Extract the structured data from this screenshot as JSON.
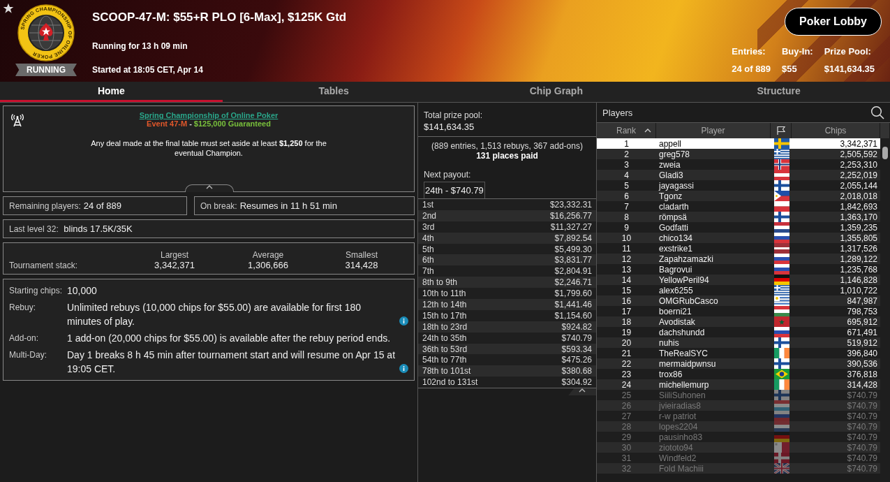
{
  "header": {
    "logo_text": "SPRING CHAMPIONSHIP OF ONLINE POKER",
    "status_badge": "RUNNING",
    "title": "SCOOP-47-M: $55+R PLO [6-Max], $125K Gtd",
    "running_for": "Running for 13 h 09 min",
    "started_at": "Started at 18:05 CET, Apr 14",
    "lobby_button": "Poker Lobby",
    "stats": [
      {
        "label": "Entries:",
        "value": "24 of 889"
      },
      {
        "label": "Buy-In:",
        "value": "$55"
      },
      {
        "label": "Prize Pool:",
        "value": "$141,634.35"
      }
    ]
  },
  "tabs": [
    {
      "label": "Home",
      "selected": true
    },
    {
      "label": "Tables",
      "selected": false
    },
    {
      "label": "Chip Graph",
      "selected": false
    },
    {
      "label": "Structure",
      "selected": false
    }
  ],
  "info": {
    "link": "Spring Championship of Online Poker",
    "event": "Event 47-M",
    "separator": "-",
    "guarantee": "$125,000 Guaranteed",
    "notice": "Any deal made at the final table must set aside at least **$1,250** for the eventual Champion."
  },
  "remaining": {
    "label": "Remaining players:",
    "value": "24 of 889"
  },
  "on_break": {
    "label": "On break:",
    "value": "Resumes in 11 h 51 min"
  },
  "last_level": {
    "label": "Last level 32:",
    "value": "blinds 17.5K/35K"
  },
  "stack": {
    "label": "Tournament stack:",
    "columns": [
      {
        "heading": "Largest",
        "value": "3,342,371"
      },
      {
        "heading": "Average",
        "value": "1,306,666"
      },
      {
        "heading": "Smallest",
        "value": "314,428"
      }
    ]
  },
  "details": [
    {
      "label": "Starting chips:",
      "value": "10,000",
      "info": false
    },
    {
      "label": "Rebuy:",
      "value": "Unlimited rebuys (10,000 chips for $55.00) are available for first 180 minutes of play.",
      "info": true
    },
    {
      "label": "Add-on:",
      "value": "1 add-on (20,000 chips for $55.00) is available after the rebuy period ends.",
      "info": false
    },
    {
      "label": "Multi-Day:",
      "value": "Day 1 breaks 8 h 45 min after tournament start and will resume on Apr 15 at 19:05 CET.",
      "info": true
    }
  ],
  "prize": {
    "label": "Total prize pool:",
    "value": "$141,634.35",
    "summary": "(889 entries, 1,513 rebuys, 367 add-ons)",
    "places_paid": "131 places paid",
    "next_payout_label": "Next payout:",
    "next_payout": "24th - $740.79",
    "payouts": [
      {
        "place": "1st",
        "amount": "$23,332.31"
      },
      {
        "place": "2nd",
        "amount": "$16,256.77"
      },
      {
        "place": "3rd",
        "amount": "$11,327.27"
      },
      {
        "place": "4th",
        "amount": "$7,892.54"
      },
      {
        "place": "5th",
        "amount": "$5,499.30"
      },
      {
        "place": "6th",
        "amount": "$3,831.77"
      },
      {
        "place": "7th",
        "amount": "$2,804.91"
      },
      {
        "place": "8th to 9th",
        "amount": "$2,246.71"
      },
      {
        "place": "10th to 11th",
        "amount": "$1,799.60"
      },
      {
        "place": "12th to 14th",
        "amount": "$1,441.46"
      },
      {
        "place": "15th to 17th",
        "amount": "$1,154.60"
      },
      {
        "place": "18th to 23rd",
        "amount": "$924.82"
      },
      {
        "place": "24th to 35th",
        "amount": "$740.79"
      },
      {
        "place": "36th to 53rd",
        "amount": "$593.34"
      },
      {
        "place": "54th to 77th",
        "amount": "$475.26"
      },
      {
        "place": "78th to 101st",
        "amount": "$380.68"
      },
      {
        "place": "102nd to 131st",
        "amount": "$304.92"
      }
    ]
  },
  "players": {
    "title": "Players",
    "header": {
      "rank": "Rank",
      "rank_sorted": true,
      "player": "Player",
      "chips": "Chips"
    },
    "rows": [
      {
        "rank": "1",
        "name": "appell",
        "flag": {
          "kind": "se"
        },
        "chips": "3,342,371",
        "selected": true,
        "eliminated": false
      },
      {
        "rank": "2",
        "name": "greg578",
        "flag": {
          "kind": "gr"
        },
        "chips": "2,505,592",
        "selected": false,
        "eliminated": false
      },
      {
        "rank": "3",
        "name": "zweia",
        "flag": {
          "kind": "no"
        },
        "chips": "2,253,310",
        "selected": false,
        "eliminated": false
      },
      {
        "rank": "4",
        "name": "Gladi3",
        "flag": {
          "kind": "at"
        },
        "chips": "2,252,019",
        "selected": false,
        "eliminated": false
      },
      {
        "rank": "5",
        "name": "jayagassi",
        "flag": {
          "kind": "fi"
        },
        "chips": "2,055,144",
        "selected": false,
        "eliminated": false
      },
      {
        "rank": "6",
        "name": "Tgonz",
        "flag": {
          "kind": "ph"
        },
        "chips": "2,018,018",
        "selected": false,
        "eliminated": false
      },
      {
        "rank": "7",
        "name": "cladarth",
        "flag": {
          "kind": "pl"
        },
        "chips": "1,842,693",
        "selected": false,
        "eliminated": false
      },
      {
        "rank": "8",
        "name": "römpsä",
        "flag": {
          "kind": "fi"
        },
        "chips": "1,363,170",
        "selected": false,
        "eliminated": false
      },
      {
        "rank": "9",
        "name": "Godfatti",
        "flag": {
          "kind": "nl"
        },
        "chips": "1,359,235",
        "selected": false,
        "eliminated": false
      },
      {
        "rank": "10",
        "name": "chico134",
        "flag": {
          "kind": "ru"
        },
        "chips": "1,355,805",
        "selected": false,
        "eliminated": false
      },
      {
        "rank": "11",
        "name": "exstrike1",
        "flag": {
          "kind": "lv"
        },
        "chips": "1,317,526",
        "selected": false,
        "eliminated": false
      },
      {
        "rank": "12",
        "name": "Zapahzamazki",
        "flag": {
          "kind": "ru"
        },
        "chips": "1,289,122",
        "selected": false,
        "eliminated": false
      },
      {
        "rank": "13",
        "name": "Bagrovui",
        "flag": {
          "kind": "ru"
        },
        "chips": "1,235,768",
        "selected": false,
        "eliminated": false
      },
      {
        "rank": "14",
        "name": "YellowPeril94",
        "flag": {
          "kind": "de"
        },
        "chips": "1,146,828",
        "selected": false,
        "eliminated": false
      },
      {
        "rank": "15",
        "name": "alex6255",
        "flag": {
          "kind": "gr"
        },
        "chips": "1,010,722",
        "selected": false,
        "eliminated": false
      },
      {
        "rank": "16",
        "name": "OMGRubCasco",
        "flag": {
          "kind": "uy"
        },
        "chips": "847,987",
        "selected": false,
        "eliminated": false
      },
      {
        "rank": "17",
        "name": "boerni21",
        "flag": {
          "kind": "hu"
        },
        "chips": "798,753",
        "selected": false,
        "eliminated": false
      },
      {
        "rank": "18",
        "name": "Avodistak",
        "flag": {
          "kind": "ma"
        },
        "chips": "695,912",
        "selected": false,
        "eliminated": false
      },
      {
        "rank": "19",
        "name": "dachshundd",
        "flag": {
          "kind": "ru"
        },
        "chips": "671,491",
        "selected": false,
        "eliminated": false
      },
      {
        "rank": "20",
        "name": "nuhis",
        "flag": {
          "kind": "fi"
        },
        "chips": "519,912",
        "selected": false,
        "eliminated": false
      },
      {
        "rank": "21",
        "name": "TheRealSYC",
        "flag": {
          "kind": "ie"
        },
        "chips": "396,840",
        "selected": false,
        "eliminated": false
      },
      {
        "rank": "22",
        "name": "mermaidpwnsu",
        "flag": {
          "kind": "fi"
        },
        "chips": "390,536",
        "selected": false,
        "eliminated": false
      },
      {
        "rank": "23",
        "name": "trox86",
        "flag": {
          "kind": "br"
        },
        "chips": "376,818",
        "selected": false,
        "eliminated": false
      },
      {
        "rank": "24",
        "name": "michellemurp",
        "flag": {
          "kind": "ie"
        },
        "chips": "314,428",
        "selected": false,
        "eliminated": false
      },
      {
        "rank": "25",
        "name": "SiiliSuhonen",
        "flag": {
          "kind": "fi"
        },
        "chips": "$740.79",
        "selected": false,
        "eliminated": true
      },
      {
        "rank": "26",
        "name": "jvieiradias8",
        "flag": {
          "kind": "lu"
        },
        "chips": "$740.79",
        "selected": false,
        "eliminated": true
      },
      {
        "rank": "27",
        "name": "r-w patriot",
        "flag": {
          "kind": "ru"
        },
        "chips": "$740.79",
        "selected": false,
        "eliminated": true
      },
      {
        "rank": "28",
        "name": "lopes2204",
        "flag": {
          "kind": "nl"
        },
        "chips": "$740.79",
        "selected": false,
        "eliminated": true
      },
      {
        "rank": "29",
        "name": "pausinho83",
        "flag": {
          "kind": "de"
        },
        "chips": "$740.79",
        "selected": false,
        "eliminated": true
      },
      {
        "rank": "30",
        "name": "ziototo94",
        "flag": {
          "kind": "mt"
        },
        "chips": "$740.79",
        "selected": false,
        "eliminated": true
      },
      {
        "rank": "31",
        "name": "Windfeld2",
        "flag": {
          "kind": "dk"
        },
        "chips": "$740.79",
        "selected": false,
        "eliminated": true
      },
      {
        "rank": "32",
        "name": "Fold Machiii",
        "flag": {
          "kind": "gb"
        },
        "chips": "$740.79",
        "selected": false,
        "eliminated": true
      }
    ]
  }
}
